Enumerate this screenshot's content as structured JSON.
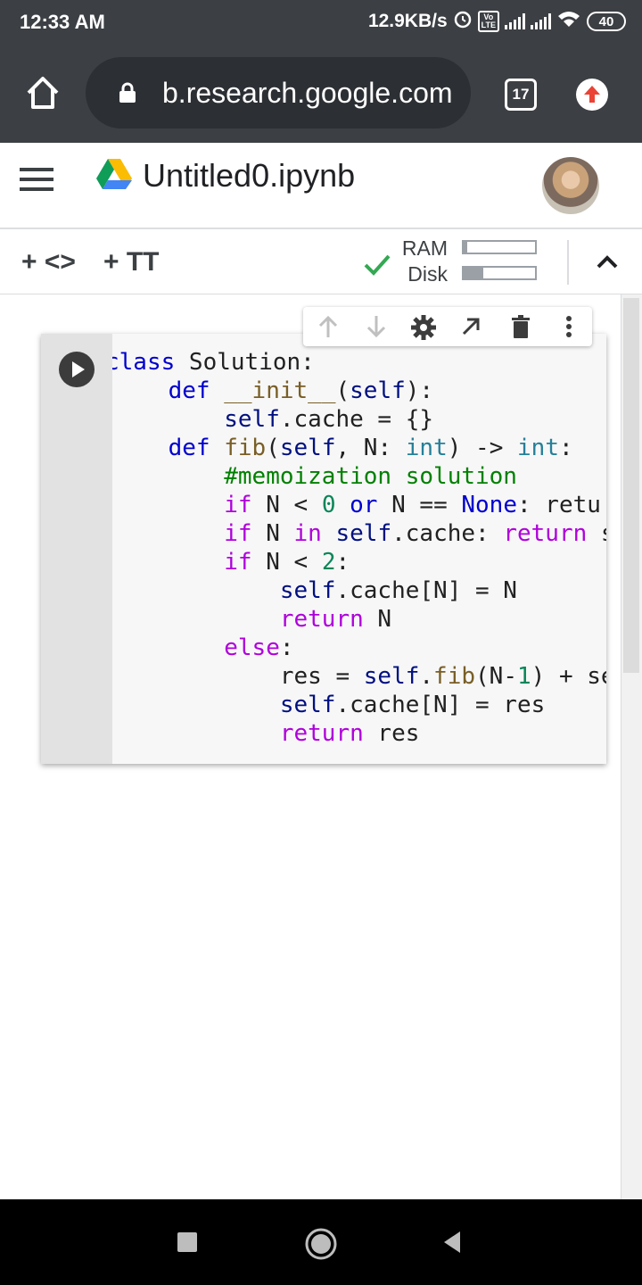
{
  "status_bar": {
    "time": "12:33 AM",
    "net_speed": "12.9KB/s",
    "battery": "40",
    "volte": "Vo LTE",
    "icons": [
      "alarm-icon",
      "volte-icon",
      "signal-icon",
      "signal-icon",
      "wifi-icon",
      "battery-icon"
    ]
  },
  "browser": {
    "url": "b.research.google.com",
    "tab_count": "17",
    "icons": [
      "home-icon",
      "lock-icon",
      "tabs-icon",
      "update-icon"
    ]
  },
  "header": {
    "title": "Untitled0.ipynb",
    "icons": [
      "menu-icon",
      "drive-logo-icon",
      "avatar"
    ]
  },
  "toolbar": {
    "add_code": "+ <>",
    "add_text": "+ TT",
    "ram_label": "RAM",
    "disk_label": "Disk",
    "ram_usage": 0.05,
    "disk_usage": 0.28,
    "icons": [
      "connected-check-icon",
      "collapse-icon"
    ]
  },
  "cell": {
    "code_lines": [
      [
        "class Solution:"
      ],
      [
        "    def __init__(self):"
      ],
      [
        "        self.cache = {}"
      ],
      [
        "    def fib(self, N: int) -> int:"
      ],
      [
        "        #memoization solution"
      ],
      [
        "        if N < 0 or N == None: retu"
      ],
      [
        "        if N in self.cache: return s"
      ],
      [
        "        if N < 2:"
      ],
      [
        "            self.cache[N] = N"
      ],
      [
        "            return N"
      ],
      [
        "        else:"
      ],
      [
        "            res = self.fib(N-1) + se"
      ],
      [
        "            self.cache[N] = res"
      ],
      [
        "            return res"
      ]
    ],
    "toolbar_icons": [
      "move-up-icon",
      "move-down-icon",
      "settings-icon",
      "open-in-new-icon",
      "delete-icon",
      "more-icon"
    ]
  },
  "nav": {
    "icons": [
      "recents-icon",
      "home-icon",
      "back-icon"
    ]
  },
  "colors": {
    "chrome_bg": "#3c3f43",
    "keyword": "#0000cf",
    "control": "#af00db",
    "comment": "#008000",
    "number": "#098658",
    "function": "#795e26",
    "builtin": "#267f99",
    "check": "#34a853"
  }
}
